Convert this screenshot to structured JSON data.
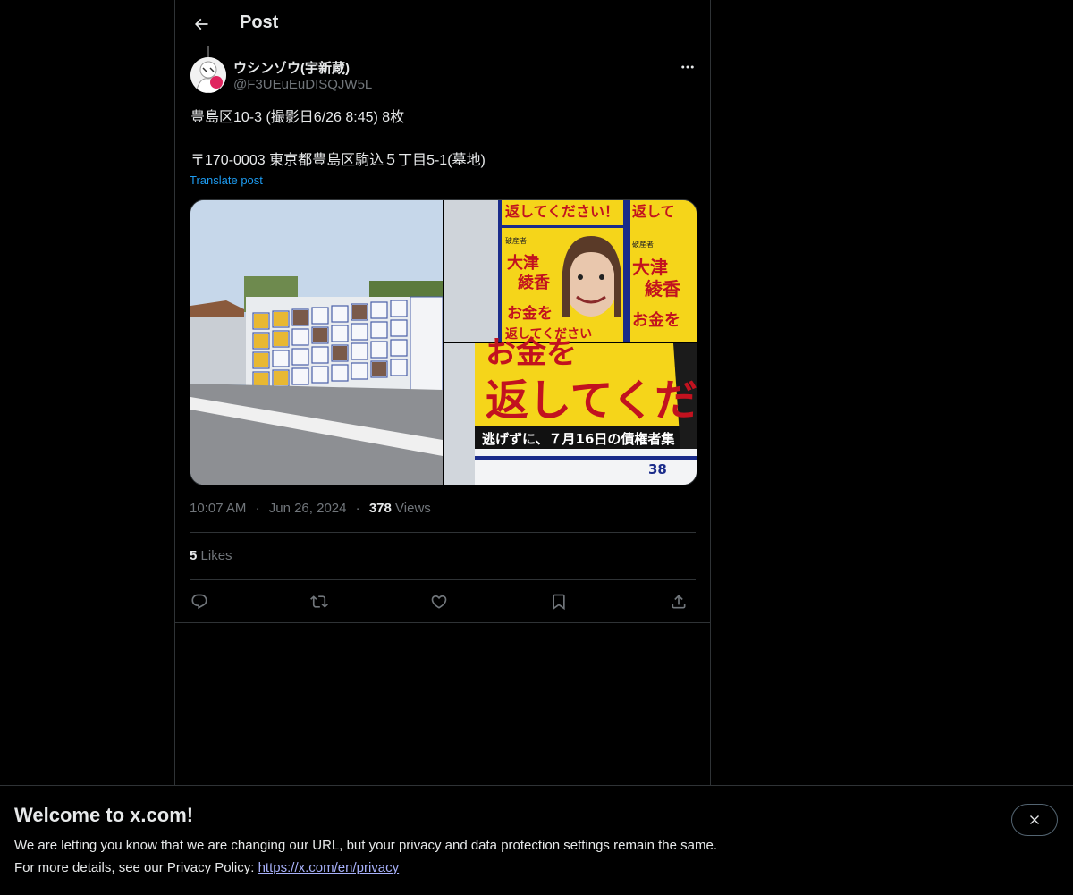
{
  "header": {
    "title": "Post"
  },
  "post": {
    "display_name": "ウシンゾウ(宇新蔵)",
    "handle": "@F3UEuEuDISQJW5L",
    "text_line1": "豊島区10-3 (撮影日6/26 8:45) 8枚",
    "text_line2": "〒170-0003 東京都豊島区駒込５丁目5-1(墓地)",
    "translate_label": "Translate post",
    "time": "10:07 AM",
    "date": "Jun 26, 2024",
    "views_count": "378",
    "views_label": "Views",
    "likes_count": "5",
    "likes_label": "Likes",
    "separator": "·"
  },
  "poster_text": {
    "title_top": "返してください！",
    "bankrupt": "破産者",
    "name": "大津",
    "name2": "綾香",
    "money": "お金を",
    "money2": "返してください",
    "big1": "お金を",
    "big2": "返してくだ",
    "strip": "逃げずに、７月16日の債権者集",
    "board_num": "38"
  },
  "banner": {
    "title": "Welcome to x.com!",
    "line1": "We are letting you know that we are changing our URL, but your privacy and data protection settings remain the same.",
    "line2_prefix": "For more details, see our Privacy Policy: ",
    "link": "https://x.com/en/privacy"
  },
  "icons": {
    "back": "arrow-left-icon",
    "more": "more-dots-icon",
    "reply": "reply-icon",
    "repost": "repost-icon",
    "like": "heart-icon",
    "bookmark": "bookmark-icon",
    "share": "share-icon",
    "close": "close-icon"
  },
  "colors": {
    "background": "#000000",
    "link": "#1d9bf0",
    "muted": "#71767b",
    "border": "#2f3336"
  }
}
